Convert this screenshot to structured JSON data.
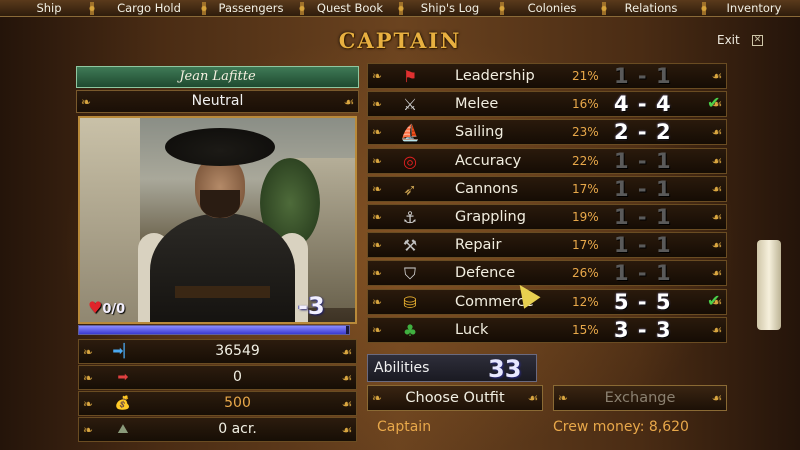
{
  "menu": [
    "Ship",
    "Cargo Hold",
    "Passengers",
    "Quest Book",
    "Ship's Log",
    "Colonies",
    "Relations",
    "Inventory"
  ],
  "title": "CAPTAIN",
  "exit_label": "Exit",
  "character": {
    "name": "Jean Lafitte",
    "reputation": "Neutral",
    "hp": "0/0",
    "level": "-3",
    "experience_fraction": 0.99
  },
  "stats": [
    {
      "icon": "experience-arrow-icon",
      "value": "36549"
    },
    {
      "icon": "next-level-arrow-icon",
      "value": "0"
    },
    {
      "icon": "money-bag-icon",
      "value": "500"
    },
    {
      "icon": "land-estate-icon",
      "value": "0 acr."
    }
  ],
  "skills": [
    {
      "name": "Leadership",
      "pct": "21%",
      "level": "1 - 1",
      "maxed": false,
      "icon": "flag-icon"
    },
    {
      "name": "Melee",
      "pct": "16%",
      "level": "4 - 4",
      "maxed": true,
      "icon": "crossed-swords-icon"
    },
    {
      "name": "Sailing",
      "pct": "23%",
      "level": "2 - 2",
      "maxed": false,
      "icon": "sail-icon"
    },
    {
      "name": "Accuracy",
      "pct": "22%",
      "level": "1 - 1",
      "maxed": false,
      "icon": "target-icon"
    },
    {
      "name": "Cannons",
      "pct": "17%",
      "level": "1 - 1",
      "maxed": false,
      "icon": "cannon-icon"
    },
    {
      "name": "Grappling",
      "pct": "19%",
      "level": "1 - 1",
      "maxed": false,
      "icon": "grappling-hook-icon"
    },
    {
      "name": "Repair",
      "pct": "17%",
      "level": "1 - 1",
      "maxed": false,
      "icon": "hammer-icon"
    },
    {
      "name": "Defence",
      "pct": "26%",
      "level": "1 - 1",
      "maxed": false,
      "icon": "shield-icon"
    },
    {
      "name": "Commerce",
      "pct": "12%",
      "level": "5 - 5",
      "maxed": true,
      "icon": "coins-icon"
    },
    {
      "name": "Luck",
      "pct": "15%",
      "level": "3 - 3",
      "maxed": false,
      "icon": "clover-icon"
    }
  ],
  "abilities": {
    "label": "Abilities",
    "value": "33"
  },
  "buttons": {
    "choose_outfit": "Choose Outfit",
    "exchange": "Exchange"
  },
  "footer": {
    "role": "Captain",
    "crew_money": "Crew money: 8,620"
  },
  "colors": {
    "accent": "#e8a84a",
    "title": "#e8b040",
    "name_bar": "#2f6a46"
  }
}
